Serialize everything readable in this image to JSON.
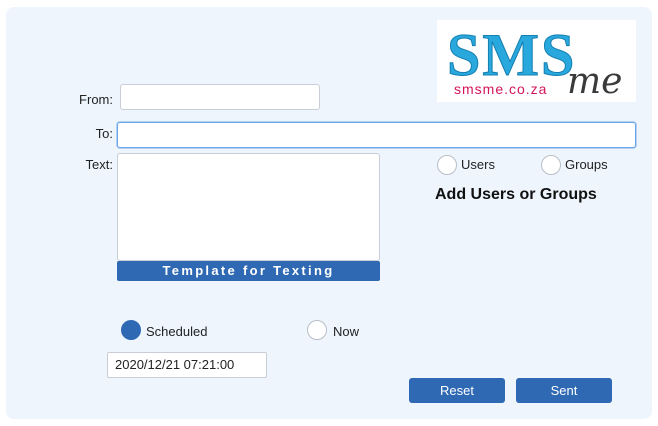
{
  "logo": {
    "brand": "SMS",
    "script": "me",
    "url": "smsme.co.za"
  },
  "form": {
    "from_label": "From:",
    "from_value": "",
    "to_label": "To:",
    "to_value": "",
    "text_label": "Text:",
    "text_value": "",
    "template_button": "Template for Texting"
  },
  "recipients": {
    "users_label": "Users",
    "groups_label": "Groups",
    "heading": "Add Users or Groups"
  },
  "schedule": {
    "scheduled_label": "Scheduled",
    "now_label": "Now",
    "selected": "Scheduled",
    "datetime_value": "2020/12/21 07:21:00"
  },
  "actions": {
    "reset_label": "Reset",
    "sent_label": "Sent"
  },
  "colors": {
    "accent": "#2f69b4",
    "panel_bg": "#eef5fd",
    "logo_blue": "#29a8de",
    "logo_dark": "#3a3a3a",
    "logo_url": "#d4145a"
  }
}
